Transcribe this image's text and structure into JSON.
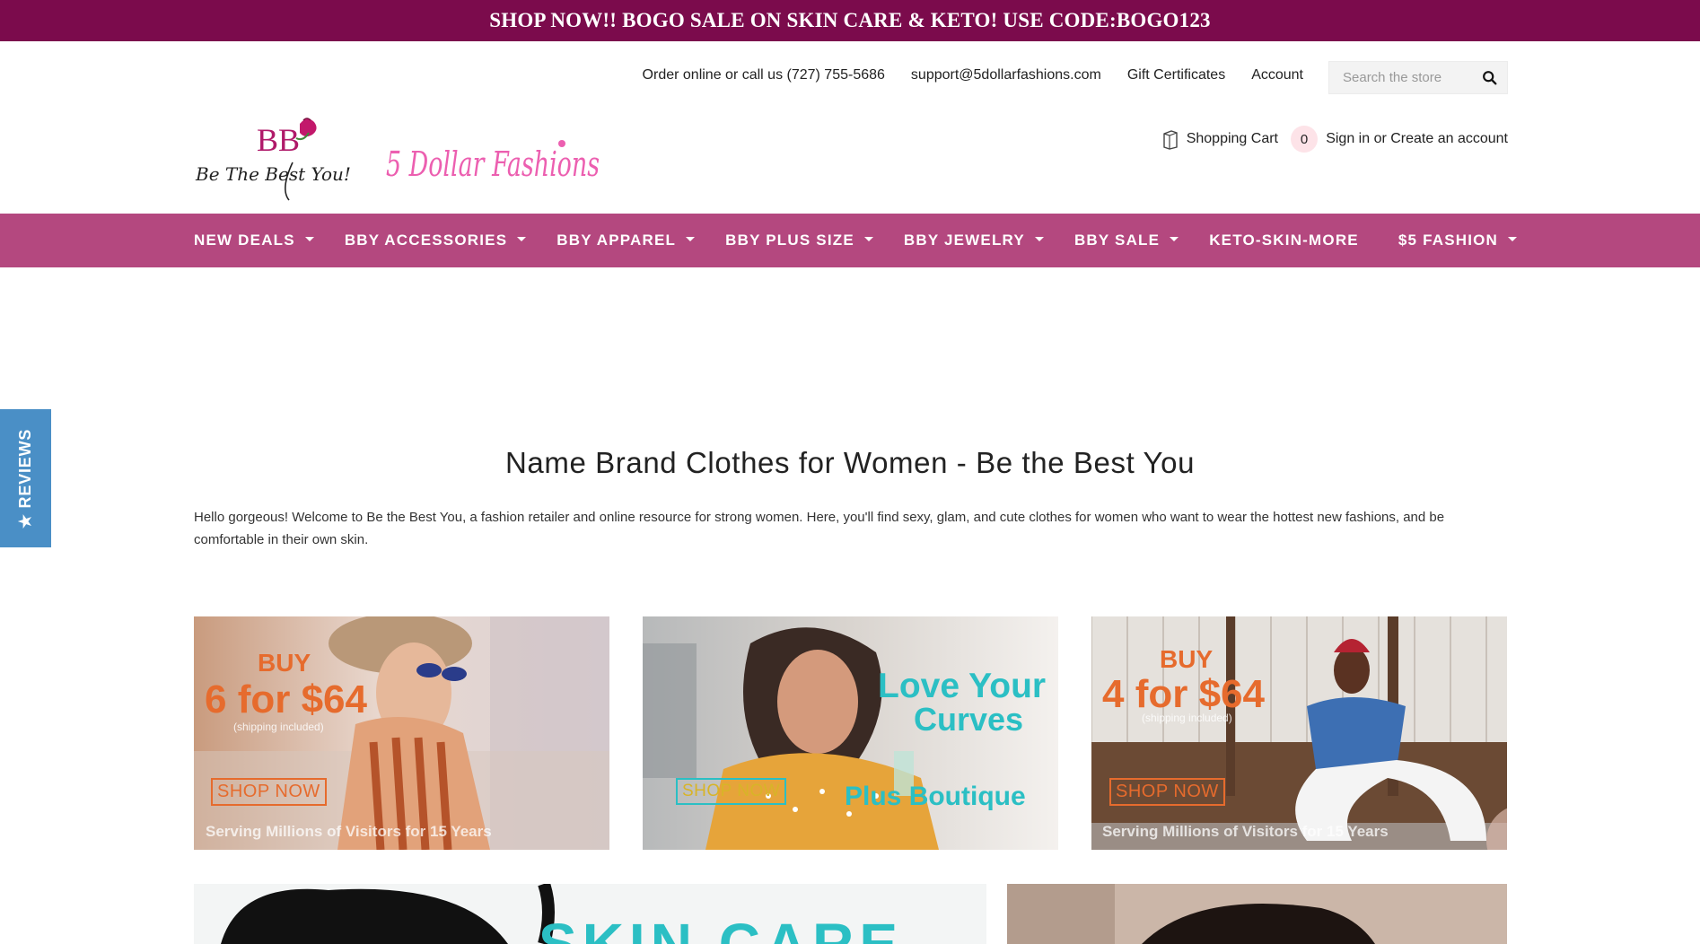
{
  "promo": {
    "text": "SHOP NOW!! BOGO SALE ON SKIN CARE & KETO! USE CODE:BOGO123"
  },
  "toplinks": {
    "phone": "Order online or call us (727) 755-5686",
    "email": "support@5dollarfashions.com",
    "gift": "Gift Certificates",
    "account": "Account"
  },
  "search": {
    "placeholder": "Search the store",
    "icon": "search-icon"
  },
  "logos": {
    "bby_text": "BB",
    "bby_script": "Be The Best You!",
    "dollar_text": "5 Dollar Fashions"
  },
  "cart": {
    "label": "Shopping Cart",
    "count": "0",
    "icon": "shopping-bag-icon"
  },
  "auth": {
    "signin": "Sign in",
    "or": "or",
    "create": "Create an account"
  },
  "nav": {
    "items": [
      {
        "label": "NEW DEALS",
        "has_caret": true
      },
      {
        "label": "BBY ACCESSORIES",
        "has_caret": true
      },
      {
        "label": "BBY APPAREL",
        "has_caret": true
      },
      {
        "label": "BBY PLUS SIZE",
        "has_caret": true
      },
      {
        "label": "BBY JEWELRY",
        "has_caret": true
      },
      {
        "label": "BBY SALE",
        "has_caret": true
      },
      {
        "label": "KETO-SKIN-MORE",
        "has_caret": false
      },
      {
        "label": "$5 FASHION",
        "has_caret": true
      }
    ]
  },
  "reviews_tab": {
    "label": "★ REVIEWS"
  },
  "main": {
    "headline": "Name Brand Clothes for Women - Be the Best You",
    "intro": "Hello gorgeous! Welcome to Be the Best You, a fashion retailer and online resource for strong women. Here, you'll find sexy, glam, and cute clothes for women who want to wear the hottest new fashions, and be comfortable in their own skin."
  },
  "banners": [
    {
      "buy": "BUY",
      "deal": "6 for $64",
      "ship": "(shipping included)",
      "shop": "SHOP NOW",
      "serving": "Serving Millions of Visitors for 15 Years"
    },
    {
      "line1": "Love Your",
      "line2": "Curves",
      "shop": "SHOP NOW",
      "sub": "Plus Boutique"
    },
    {
      "buy": "BUY",
      "deal": "4 for $64",
      "ship": "(shipping included)",
      "shop": "SHOP NOW",
      "serving": "Serving Millions of Visitors for 15 Years"
    },
    {
      "title": "SKIN CARE"
    },
    {
      "title": ""
    }
  ],
  "colors": {
    "promo_bg": "#7b0b4c",
    "nav_bg": "#b4487f",
    "reviews_bg": "#4a8fc6",
    "accent_orange": "#e66b2d",
    "accent_teal": "#2bbfc4"
  }
}
